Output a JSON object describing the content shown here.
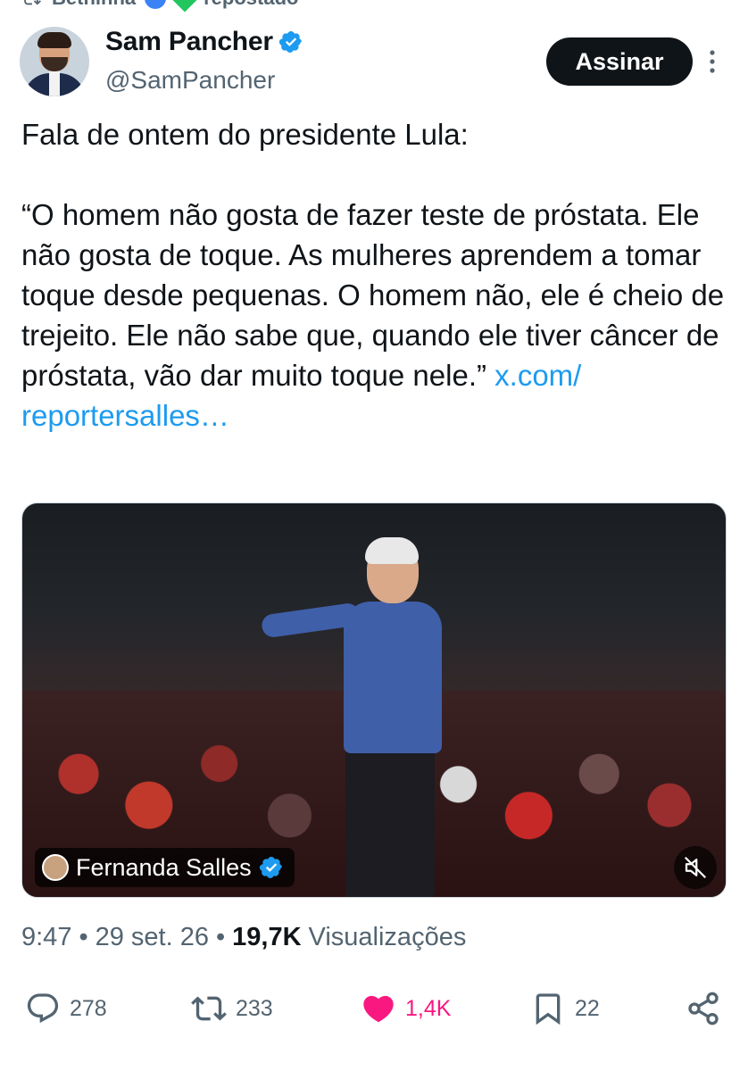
{
  "repost_header": {
    "name": "Bethinha",
    "label": "repostado"
  },
  "author": {
    "display_name": "Sam Pancher",
    "handle": "@SamPancher",
    "verified": true
  },
  "subscribe_button": "Assinar",
  "tweet": {
    "intro": "Fala de ontem do presidente Lula:",
    "quote": "“O homem não gosta de fazer teste de próstata. Ele não gosta de toque. As mulheres aprendem a tomar toque desde pequenas. O homem não, ele é cheio de trejeito. Ele não sabe que, quando ele tiver câncer de próstata, vão dar muito toque nele.”",
    "link_text": "x.com/\nreportersalles…"
  },
  "media": {
    "attribution_name": "Fernanda Salles",
    "attribution_verified": true,
    "muted": true
  },
  "meta": {
    "time": "9:47",
    "date": "29 set. 26",
    "separator": "•",
    "views_count": "19,7K",
    "views_label": "Visualizações"
  },
  "actions": {
    "replies": "278",
    "reposts": "233",
    "likes": "1,4K",
    "bookmarks": "22"
  },
  "colors": {
    "link": "#1d9bf0",
    "like": "#f91880",
    "verified": "#1d9bf0",
    "secondary_text": "#536471"
  }
}
